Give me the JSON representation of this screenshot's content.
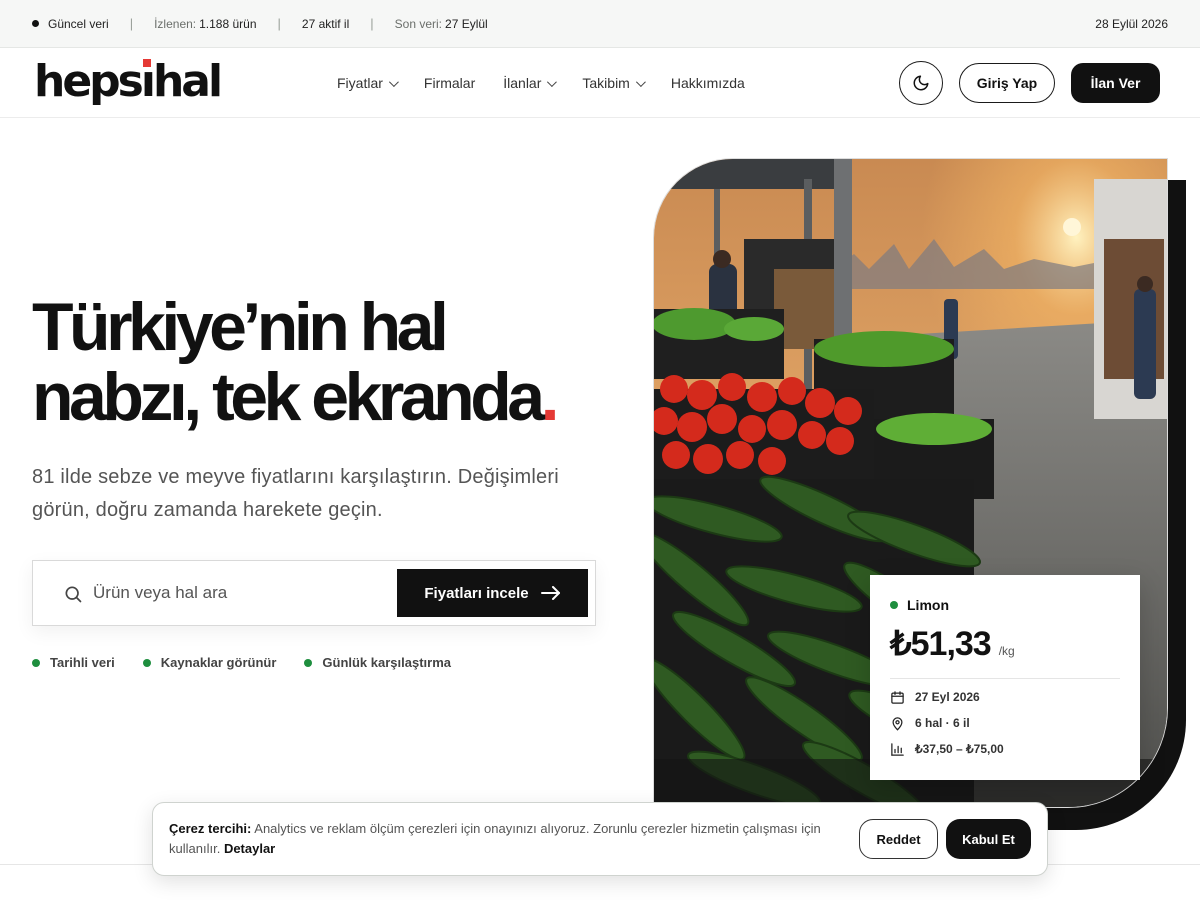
{
  "topbar": {
    "live_label": "Güncel veri",
    "tracked_label": "İzlenen:",
    "tracked_value": "1.188 ürün",
    "active_label": "27 aktif il",
    "last_label": "Son veri:",
    "last_value": "27 Eylül",
    "date": "28 Eylül 2026"
  },
  "header": {
    "logo": "hepsihal",
    "nav": [
      {
        "label": "Fiyatlar",
        "has_menu": true
      },
      {
        "label": "Firmalar",
        "has_menu": false
      },
      {
        "label": "İlanlar",
        "has_menu": true
      },
      {
        "label": "Takibim",
        "has_menu": true
      },
      {
        "label": "Hakkımızda",
        "has_menu": false
      }
    ],
    "theme_icon": "moon-icon",
    "login_label": "Giriş Yap",
    "post_label": "İlan Ver"
  },
  "hero": {
    "title_line1": "Türkiye’nin hal",
    "title_line2": "nabzı, tek ekranda",
    "title_period": ".",
    "subtitle": "81 ilde sebze ve meyve fiyatlarını karşılaştırın. Değişimleri görün, doğru zamanda harekete geçin.",
    "search": {
      "placeholder": "Ürün veya hal ara",
      "value": "",
      "button_label": "Fiyatları incele"
    },
    "features": [
      "Tarihli veri",
      "Kaynaklar görünür",
      "Günlük karşılaştırma"
    ]
  },
  "price_card": {
    "product": "Limon",
    "price": "₺51,33",
    "unit": "/kg",
    "date": "27 Eyl 2026",
    "sources": "6 hal · 6 il",
    "range": "₺37,50 – ₺75,00"
  },
  "cookie": {
    "title": "Çerez tercihi:",
    "text": "Analytics ve reklam ölçüm çerezleri için onayınızı alıyoruz. Zorunlu çerezler hizmetin çalışması için kullanılır.",
    "details_label": "Detaylar",
    "reject_label": "Reddet",
    "accept_label": "Kabul Et"
  },
  "colors": {
    "accent_red": "#e53935",
    "status_green": "#1e8e3e",
    "dark": "#111111"
  }
}
